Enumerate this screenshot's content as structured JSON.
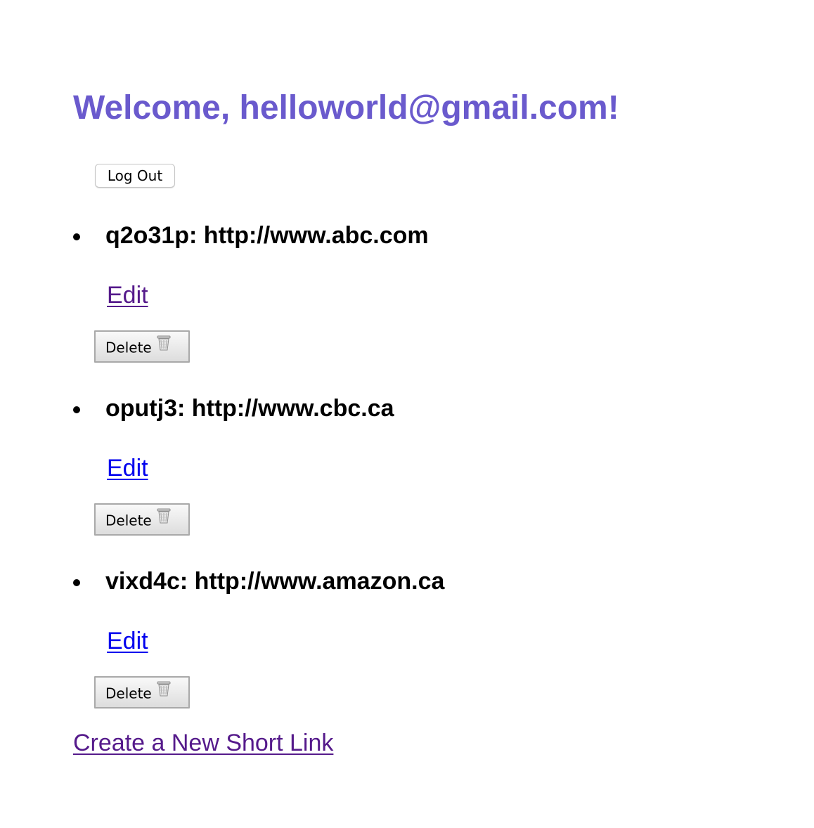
{
  "header": {
    "welcome": "Welcome, helloworld@gmail.com!",
    "color": "#6a5acd"
  },
  "logout_label": "Log Out",
  "links": [
    {
      "text": "q2o31p: http://www.abc.com",
      "edit_label": "Edit",
      "edit_visited": true,
      "delete_label": "Delete",
      "delete_icon": "trash-icon"
    },
    {
      "text": "oputj3: http://www.cbc.ca",
      "edit_label": "Edit",
      "edit_visited": false,
      "delete_label": "Delete",
      "delete_icon": "trash-icon"
    },
    {
      "text": "vixd4c: http://www.amazon.ca",
      "edit_label": "Edit",
      "edit_visited": false,
      "delete_label": "Delete",
      "delete_icon": "trash-icon"
    }
  ],
  "create_link": "Create a New Short Link",
  "colors": {
    "visited_link": "#551a8b",
    "link": "#0000ee"
  }
}
